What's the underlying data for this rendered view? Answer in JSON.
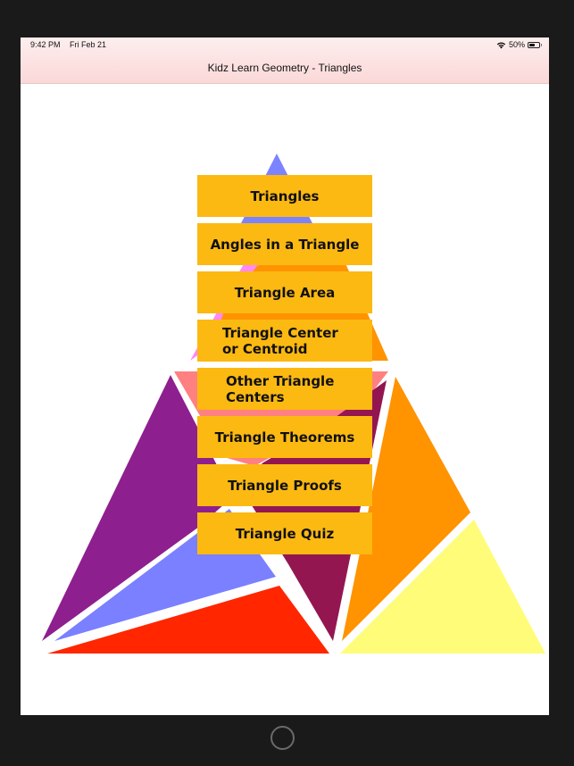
{
  "status_bar": {
    "time": "9:42 PM",
    "date": "Fri Feb 21",
    "battery_percent": "50%",
    "battery_level": 0.5,
    "icons": [
      "wifi-icon",
      "battery-icon"
    ]
  },
  "navbar": {
    "title": "Kidz Learn Geometry - Triangles"
  },
  "menu": {
    "items": [
      {
        "label": "Triangles"
      },
      {
        "label": "Angles in a Triangle"
      },
      {
        "label": "Triangle Area"
      },
      {
        "label": "Triangle Center\nor Centroid"
      },
      {
        "label": "Other Triangle\nCenters"
      },
      {
        "label": "Triangle Theorems"
      },
      {
        "label": "Triangle Proofs"
      },
      {
        "label": "Triangle Quiz"
      }
    ]
  },
  "colors": {
    "button_bg": "#fcb912",
    "blue": "#7b83ff",
    "pink": "#ff88ff",
    "orange": "#ff9300",
    "salmon": "#ff8080",
    "purple": "#8e1f8e",
    "maroon": "#941651",
    "periwinkle": "#7a80ff",
    "red": "#ff2600",
    "yellow": "#fffc79"
  }
}
